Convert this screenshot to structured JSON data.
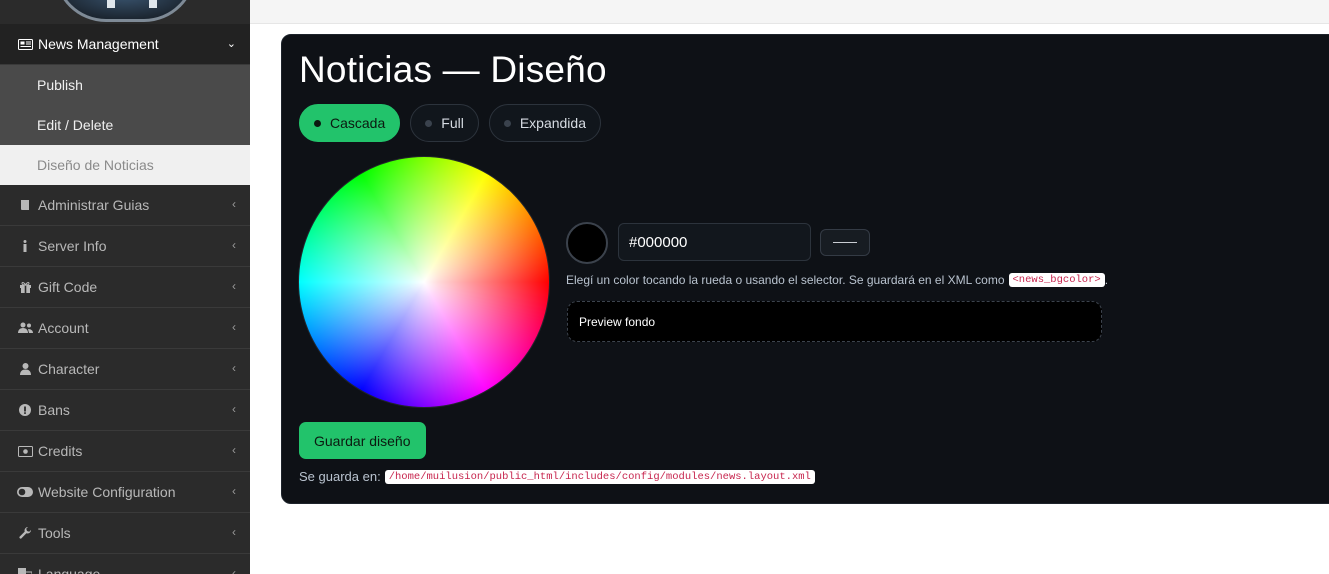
{
  "sidebar": {
    "active_section": {
      "label": "News Management",
      "icon": "newspaper-icon"
    },
    "subitems": [
      {
        "label": "Publish"
      },
      {
        "label": "Edit / Delete"
      },
      {
        "label": "Diseño de Noticias"
      }
    ],
    "items": [
      {
        "label": "Administrar Guias",
        "icon": "book-icon"
      },
      {
        "label": "Server Info",
        "icon": "info-icon"
      },
      {
        "label": "Gift Code",
        "icon": "gift-icon"
      },
      {
        "label": "Account",
        "icon": "users-icon"
      },
      {
        "label": "Character",
        "icon": "user-icon"
      },
      {
        "label": "Bans",
        "icon": "exclamation-icon"
      },
      {
        "label": "Credits",
        "icon": "money-icon"
      },
      {
        "label": "Website Configuration",
        "icon": "toggle-icon"
      },
      {
        "label": "Tools",
        "icon": "wrench-icon"
      },
      {
        "label": "Language",
        "icon": "language-icon"
      }
    ]
  },
  "main": {
    "title": "Noticias — Diseño",
    "tabs": [
      {
        "label": "Cascada",
        "active": true
      },
      {
        "label": "Full",
        "active": false
      },
      {
        "label": "Expandida",
        "active": false
      }
    ],
    "color": {
      "hex_value": "#000000",
      "hint_text": "Elegí un color tocando la rueda o usando el selector. Se guardará en el XML como",
      "xml_key": "<news_bgcolor>",
      "hint_end": ".",
      "preview_label": "Preview fondo"
    },
    "save_label": "Guardar diseño",
    "saved_prefix": "Se guarda en:",
    "saved_path": "/home/muilusion/public_html/includes/config/modules/news.layout.xml"
  },
  "colors": {
    "accent": "#22c36b",
    "panel_bg": "#0e1116",
    "sidebar_bg": "#2b2b2b"
  }
}
